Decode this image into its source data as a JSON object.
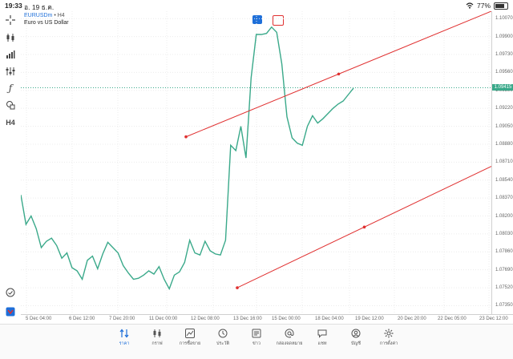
{
  "status_bar": {
    "time": "19:33",
    "date": "อ. 19 ธ.ค.",
    "battery": "77%",
    "battery_level": 0.77
  },
  "symbol": {
    "name": "EURUSDm",
    "timeframe": "• H4",
    "description": "Euro vs US Dollar"
  },
  "left_toolbar": [
    "crosshair-icon",
    "candlestick-icon",
    "bar-chart-icon",
    "indicators-icon",
    "function-icon",
    "objects-icon",
    "H4",
    "alert-icon",
    "app-logo-icon"
  ],
  "left_toolbar_text": {
    "timeframe": "H4"
  },
  "price_axis": {
    "labels": [
      "1.10070",
      "1.09900",
      "1.09730",
      "1.09560",
      "1.09390",
      "1.09220",
      "1.09050",
      "1.08880",
      "1.08710",
      "1.08540",
      "1.08370",
      "1.08200",
      "1.08030",
      "1.07860",
      "1.07690",
      "1.07520",
      "1.07350"
    ],
    "current_price": "1.09415"
  },
  "time_axis": {
    "labels": [
      "5 Dec 04:00",
      "6 Dec 12:00",
      "7 Dec 20:00",
      "11 Dec 00:00",
      "12 Dec 08:00",
      "13 Dec 16:00",
      "15 Dec 00:00",
      "18 Dec 04:00",
      "19 Dec 12:00",
      "20 Dec 20:00",
      "22 Dec 05:00",
      "23 Dec 12:00"
    ]
  },
  "colors": {
    "line": "#3aa98a",
    "trend": "#e03030",
    "accent": "#1e6fd9"
  },
  "tabs": [
    {
      "label": "ราคา",
      "icon": "quotes-icon",
      "active": true
    },
    {
      "label": "กราฟ",
      "icon": "chart-icon",
      "active": false
    },
    {
      "label": "การซื้อขาย",
      "icon": "trade-icon",
      "active": false
    },
    {
      "label": "ประวัติ",
      "icon": "history-icon",
      "active": false
    },
    {
      "label": "ข่าว",
      "icon": "news-icon",
      "active": false
    },
    {
      "label": "กล่องจดหมาย",
      "icon": "mailbox-icon",
      "active": false
    },
    {
      "label": "แชท",
      "icon": "chat-icon",
      "active": false
    },
    {
      "label": "บัญชี",
      "icon": "account-icon",
      "active": false
    },
    {
      "label": "การตั้งค่า",
      "icon": "settings-icon",
      "active": false
    }
  ],
  "chart_data": {
    "type": "line",
    "y_range": [
      1.0727,
      1.1014
    ],
    "series": [
      {
        "values": [
          1.084,
          1.0812,
          1.082,
          1.0808,
          1.079,
          1.0796,
          1.0799,
          1.0792,
          1.078,
          1.0785,
          1.0771,
          1.0768,
          1.076,
          1.0778,
          1.0782,
          1.077,
          1.0784,
          1.0795,
          1.079,
          1.0785,
          1.0773,
          1.0766,
          1.076,
          1.0761,
          1.0764,
          1.0768,
          1.0765,
          1.0772,
          1.076,
          1.0751,
          1.0764,
          1.0767,
          1.0776,
          1.0797,
          1.0785,
          1.0783,
          1.0796,
          1.0787,
          1.0784,
          1.0783,
          1.0797,
          1.0887,
          1.0882,
          1.0905,
          1.0875,
          1.0951,
          1.0992,
          1.0992,
          1.0993,
          1.0999,
          1.0994,
          1.0964,
          1.0914,
          1.0894,
          1.0889,
          1.0887,
          1.0905,
          1.0915,
          1.0908,
          1.0912,
          1.0917,
          1.0922,
          1.0926,
          1.0929,
          1.0935,
          1.0941
        ]
      }
    ],
    "trendlines": [
      {
        "x1": "13 Dec 00:00",
        "y1": 1.0895,
        "x2": "25 Dec 12:00",
        "y2": 1.1014
      },
      {
        "x1": "14 Dec 04:00",
        "y1": 1.0752,
        "x2": "25 Dec 12:00",
        "y2": 1.0867
      }
    ]
  }
}
